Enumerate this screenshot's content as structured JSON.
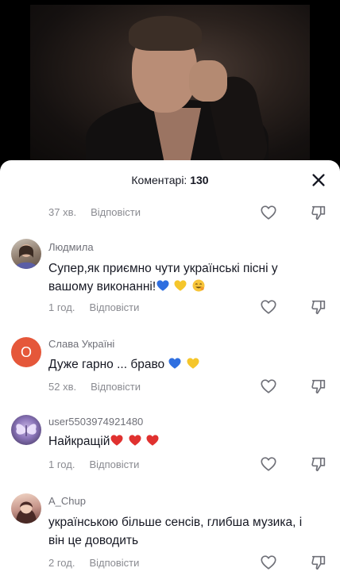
{
  "header": {
    "title_label": "Коментарі:",
    "count": "130"
  },
  "comments": [
    {
      "time": "37 хв.",
      "reply_label": "Відповісти"
    },
    {
      "username": "Людмила",
      "text": "Супер,як приємно чути українські пісні у вашому виконанні!",
      "time": "1 год.",
      "reply_label": "Відповісти",
      "emojis": [
        "blue-heart",
        "yellow-heart",
        "grin-face"
      ]
    },
    {
      "username": "Слава Україні",
      "avatar_letter": "О",
      "text": "Дуже гарно ... браво",
      "time": "52 хв.",
      "reply_label": "Відповісти",
      "emojis": [
        "blue-heart",
        "yellow-heart"
      ]
    },
    {
      "username": "user5503974921480",
      "text": "Найкращій",
      "time": "1 год.",
      "reply_label": "Відповісти",
      "emojis": [
        "red-heart",
        "red-heart",
        "red-heart"
      ]
    },
    {
      "username": "A_Chup",
      "text": "українською більше сенсів, глибша музика, і він це доводить",
      "time": "2 год.",
      "reply_label": "Відповісти"
    }
  ],
  "colors": {
    "avatar_letter_bg": "#e5573a",
    "blue_heart": "#2f6fe0",
    "yellow_heart": "#f5c62b",
    "red_heart": "#e0312f"
  }
}
